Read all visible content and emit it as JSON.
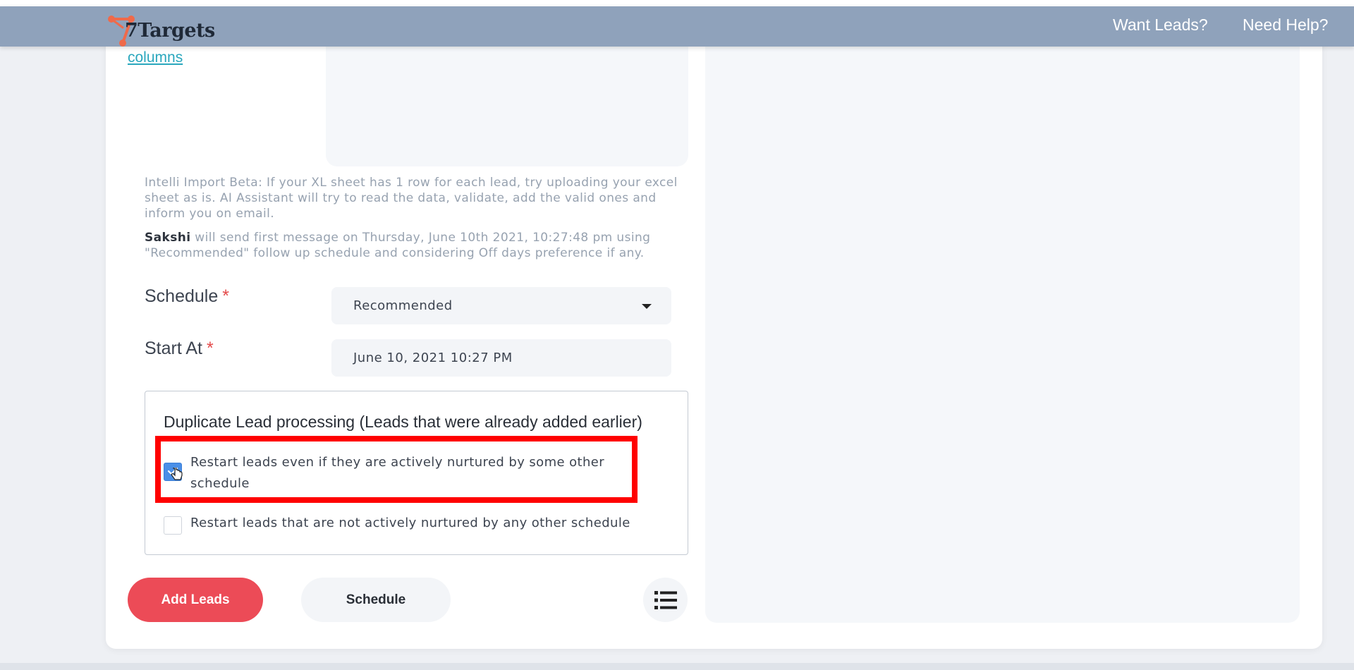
{
  "header": {
    "brand": "7Targets",
    "links": [
      "Want Leads?",
      "Need Help?"
    ]
  },
  "upload": {
    "columns_link": "columns"
  },
  "info": {
    "intelli_import": "Intelli Import Beta: If your XL sheet has 1 row for each lead, try uploading your excel sheet as is. AI Assistant will try to read the data, validate, add the valid ones and inform you on email.",
    "assistant_name": "Sakshi",
    "schedule_note": " will send first message on Thursday, June 10th 2021, 10:27:48 pm using \"Recommended\" follow up schedule and considering Off days preference if any."
  },
  "form": {
    "schedule_label": "Schedule",
    "schedule_value": "Recommended",
    "start_label": "Start At",
    "start_value": "June 10, 2021 10:27 PM",
    "required_mark": "*"
  },
  "duplicate": {
    "title": "Duplicate Lead processing (Leads that were already added earlier)",
    "options": [
      {
        "label": "Restart leads even if they are actively nurtured by some other schedule",
        "checked": true
      },
      {
        "label": "Restart leads that are not actively nurtured by any other schedule",
        "checked": false
      }
    ]
  },
  "actions": {
    "add_leads": "Add Leads",
    "schedule": "Schedule",
    "list_icon": "list-icon"
  },
  "colors": {
    "header_bg": "#8fa2bb",
    "brand_orange": "#ef6a4a",
    "link": "#2aa7bd",
    "primary": "#ec4b57",
    "checkbox": "#4a8fe7",
    "highlight": "#ff0000"
  }
}
